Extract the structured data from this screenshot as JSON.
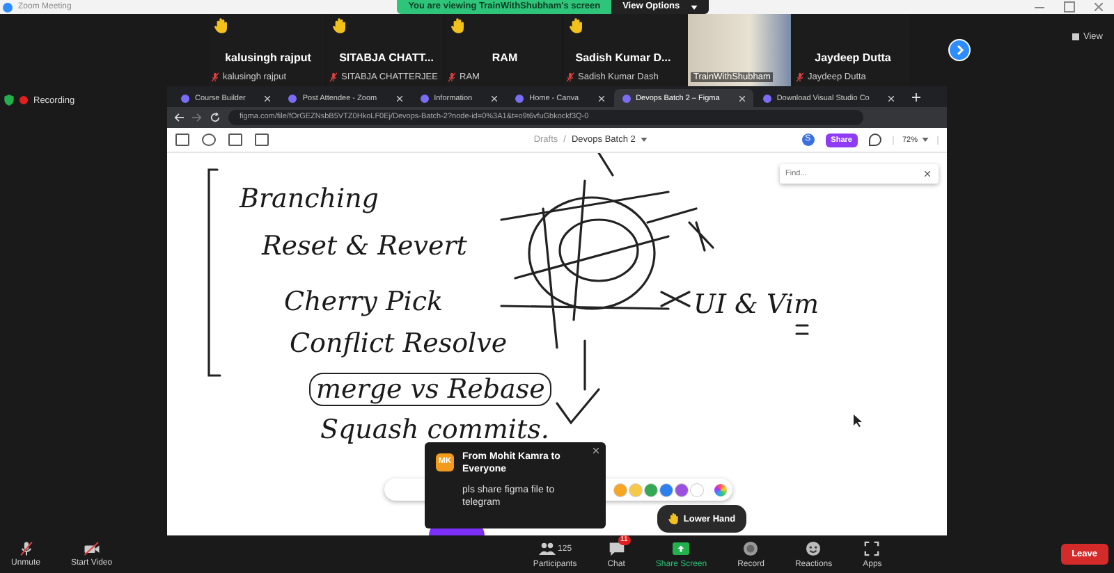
{
  "window": {
    "title": "Zoom Meeting"
  },
  "share_banner": {
    "text": "You are viewing TrainWithShubham's screen",
    "options": "View Options"
  },
  "view_button": "View",
  "recording": "Recording",
  "participants": [
    {
      "kind": "name",
      "display": "kalusingh rajput",
      "name": "kalusingh rajput",
      "hand_raised": true
    },
    {
      "kind": "name",
      "display": "SITABJA CHATT...",
      "name": "SITABJA CHATTERJEE",
      "hand_raised": true
    },
    {
      "kind": "name",
      "display": "RAM",
      "name": "RAM",
      "hand_raised": true
    },
    {
      "kind": "name",
      "display": "Sadish Kumar D...",
      "name": "Sadish Kumar Dash",
      "hand_raised": true
    },
    {
      "kind": "video",
      "name": "TrainWithShubham",
      "hand_raised": false
    },
    {
      "kind": "name",
      "display": "Jaydeep Dutta",
      "name": "Jaydeep Dutta",
      "hand_raised": false
    }
  ],
  "browser": {
    "tabs": [
      {
        "label": "Course Builder",
        "selected": false
      },
      {
        "label": "Post Attendee - Zoom",
        "selected": false
      },
      {
        "label": "Information",
        "selected": false
      },
      {
        "label": "Home - Canva",
        "selected": false
      },
      {
        "label": "Devops Batch 2 – Figma",
        "selected": true
      },
      {
        "label": "Download Visual Studio Co",
        "selected": false
      }
    ],
    "address": "figma.com/file/fOrGEZNsbB5VTZ0HkoLF0Ej/Devops-Batch-2?node-id=0%3A1&t=o9t6vfuGbkockf3Q-0"
  },
  "figma": {
    "breadcrumb_root": "Drafts",
    "separator": "/",
    "file": "Devops Batch 2",
    "avatar": "S",
    "share": "Share",
    "zoom": "72%",
    "find_placeholder": "Find..."
  },
  "whiteboard": [
    {
      "text": "Branching",
      "kind": "plain"
    },
    {
      "text": "Reset & Revert",
      "kind": "plain"
    },
    {
      "text": "Cherry Pick",
      "kind": "plain"
    },
    {
      "text": "Conflict Resolve",
      "kind": "plain"
    },
    {
      "text": "merge vs Rebase",
      "kind": "boxed"
    },
    {
      "text": "Squash commits.",
      "kind": "plain"
    },
    {
      "text": "UI & Vim",
      "kind": "plain"
    }
  ],
  "palette": [
    {
      "color": "#f5a623"
    },
    {
      "color": "#f7c948"
    },
    {
      "color": "#34a853"
    },
    {
      "color": "#2f80ed"
    },
    {
      "color": "#9b51e0"
    },
    {
      "color": "#ffffff"
    }
  ],
  "chat_popup": {
    "avatar": "MK",
    "title": "From Mohit Kamra to Everyone",
    "message": "pls share figma file to telegram"
  },
  "lower_hand": "Lower Hand",
  "toolbar": [
    {
      "kind": "mic",
      "label": "Unmute"
    },
    {
      "kind": "video",
      "label": "Start Video"
    },
    {
      "kind": "participants",
      "label": "Participants",
      "count": "125"
    },
    {
      "kind": "chat",
      "label": "Chat",
      "badge": "11"
    },
    {
      "kind": "share",
      "label": "Share Screen"
    },
    {
      "kind": "record",
      "label": "Record"
    },
    {
      "kind": "reactions",
      "label": "Reactions"
    },
    {
      "kind": "apps",
      "label": "Apps"
    }
  ],
  "leave": "Leave"
}
